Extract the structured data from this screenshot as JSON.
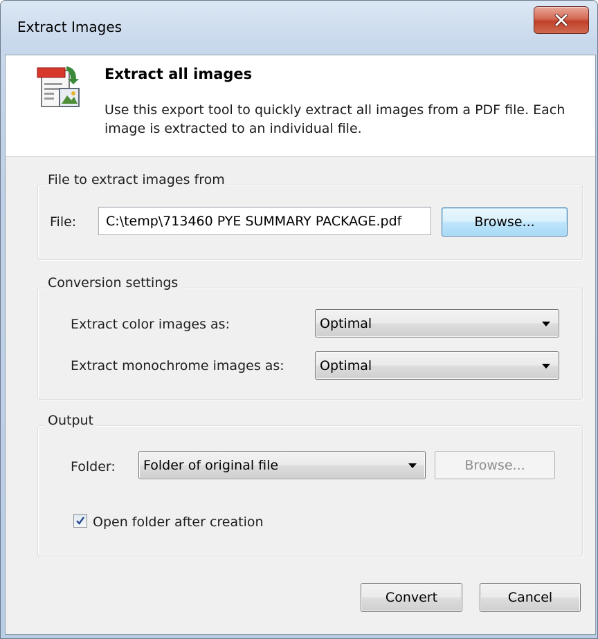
{
  "window": {
    "title": "Extract Images"
  },
  "header": {
    "title": "Extract all images",
    "description": "Use this export tool to quickly extract all images from a PDF file. Each image is extracted to an individual file."
  },
  "file_group": {
    "label": "File to extract images from",
    "file_label": "File:",
    "file_value": "C:\\temp\\713460 PYE SUMMARY PACKAGE.pdf",
    "browse_label": "Browse..."
  },
  "conversion_group": {
    "label": "Conversion settings",
    "color_label": "Extract color images as:",
    "color_value": "Optimal",
    "mono_label": "Extract monochrome images as:",
    "mono_value": "Optimal"
  },
  "output_group": {
    "label": "Output",
    "folder_label": "Folder:",
    "folder_value": "Folder of original file",
    "browse_label": "Browse...",
    "open_folder_label": "Open folder after creation",
    "open_folder_checked": true
  },
  "buttons": {
    "convert": "Convert",
    "cancel": "Cancel"
  },
  "icons": {
    "close": "close-icon",
    "header": "extract-images-icon",
    "dropdown": "chevron-down-icon",
    "check": "checkmark-icon"
  }
}
